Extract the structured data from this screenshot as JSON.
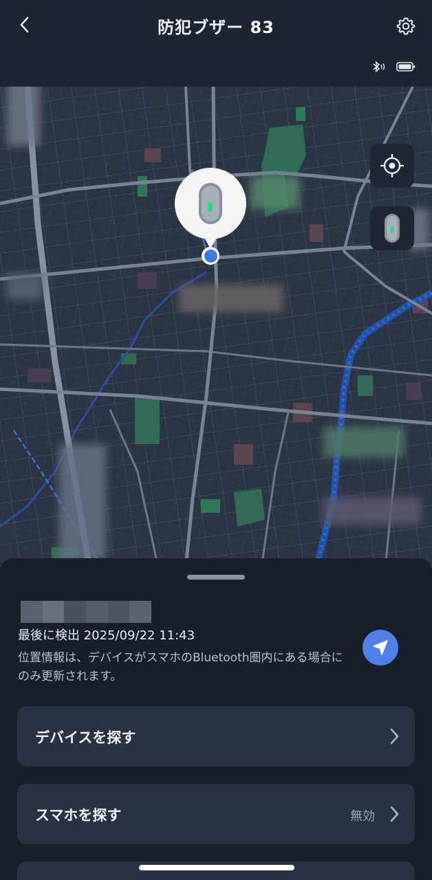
{
  "header": {
    "title": "防犯ブザー 83",
    "back_icon": "chevron-left-icon",
    "settings_icon": "gear-icon",
    "status_icons": [
      "bluetooth-icon",
      "battery-icon"
    ]
  },
  "map": {
    "locate_icon": "crosshair-icon",
    "device_icon": "buzzer-device-icon",
    "pin_icon": "buzzer-device-icon"
  },
  "sheet": {
    "last_seen": "最後に検出 2025/09/22 11:43",
    "note": "位置情報は、デバイスがスマホのBluetooth圏内にある場合にのみ更新されます。",
    "nav_icon": "navigation-arrow-icon",
    "items": [
      {
        "label": "デバイスを探す",
        "status": ""
      },
      {
        "label": "スマホを探す",
        "status": "無効"
      }
    ]
  },
  "colors": {
    "background": "#1b2230",
    "card": "#283244",
    "accent": "#4f7fe8",
    "map_base": "#2a3344"
  }
}
